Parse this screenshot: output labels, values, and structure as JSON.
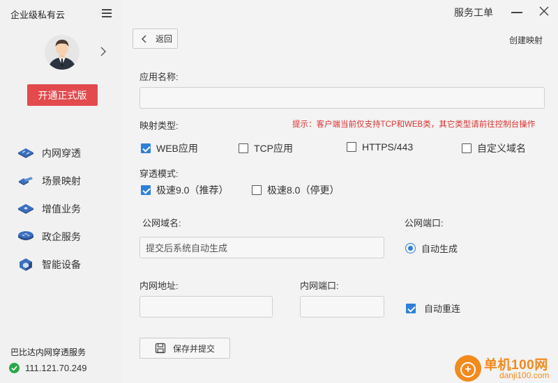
{
  "sidebar": {
    "app_title": "企业级私有云",
    "upgrade_label": "开通正式版",
    "nav": [
      {
        "label": "内网穿透",
        "icon": "tunnel-icon"
      },
      {
        "label": "场景映射",
        "icon": "scene-mapping-icon"
      },
      {
        "label": "增值业务",
        "icon": "value-added-icon"
      },
      {
        "label": "政企服务",
        "icon": "enterprise-service-icon"
      },
      {
        "label": "智能设备",
        "icon": "smart-device-icon"
      }
    ],
    "service_name": "巴比达内网穿透服务",
    "ip": "111.121.70.249",
    "status_color": "#2aa84a"
  },
  "topbar": {
    "ticket_label": "服务工单"
  },
  "main": {
    "back_label": "返回",
    "page_title": "创建映射",
    "app_name_label": "应用名称:",
    "app_name_value": "",
    "mapping_type_label": "映射类型:",
    "hint": "提示：客户端当前仅支持TCP和WEB类，其它类型请前往控制台操作",
    "mapping_types": [
      {
        "label": "WEB应用",
        "checked": true
      },
      {
        "label": "TCP应用",
        "checked": false
      },
      {
        "label": "HTTPS/443",
        "checked": false
      },
      {
        "label": "自定义域名",
        "checked": false
      }
    ],
    "mode_label": "穿透模式:",
    "modes": [
      {
        "label": "极速9.0（推荐）",
        "checked": true
      },
      {
        "label": "极速8.0（停更）",
        "checked": false
      }
    ],
    "public_domain_label": "公网域名:",
    "public_domain_placeholder": "提交后系统自动生成",
    "public_port_label": "公网端口:",
    "public_port_option": "自动生成",
    "internal_address_label": "内网地址:",
    "internal_address_value": "",
    "internal_port_label": "内网端口:",
    "internal_port_value": "",
    "auto_reconnect_label": "自动重连",
    "auto_reconnect_checked": true,
    "save_label": "保存并提交",
    "accent_color": "#2f80d8",
    "hint_color": "#d9322f"
  },
  "watermark": {
    "title": "单机100网",
    "domain": "danji100.com"
  }
}
